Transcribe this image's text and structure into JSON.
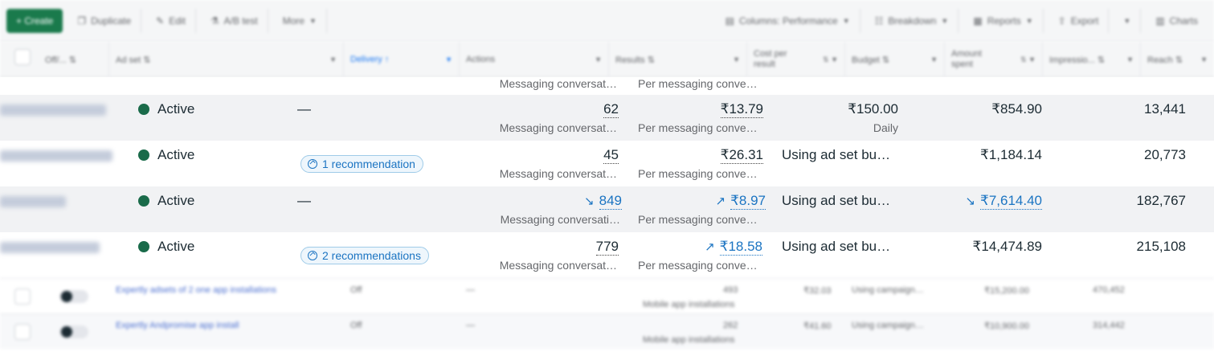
{
  "toolbar": {
    "create": "+ Create",
    "duplicate": "Duplicate",
    "edit": "Edit",
    "ab_test": "A/B test",
    "more": "More",
    "columns": "Columns: Performance",
    "breakdown": "Breakdown",
    "reports": "Reports",
    "export": "Export",
    "charts": "Charts"
  },
  "columns": {
    "off_on": "Off/... ⇅",
    "ad_set": "Ad set ⇅",
    "delivery": "Delivery ↑",
    "actions": "Actions",
    "results": "Results ⇅",
    "cost_per_result": "Cost per result",
    "budget": "Budget ⇅",
    "amount_spent": "Amount spent",
    "impressions": "Impressio... ⇅",
    "reach": "Reach ⇅"
  },
  "partial_row": {
    "results_sub": "Messaging conversat…",
    "cost_sub": "Per messaging conve…"
  },
  "rows": [
    {
      "status": "Active",
      "delivery": "—",
      "results": "62",
      "results_sub": "Messaging conversat…",
      "cost": "₹13.79",
      "cost_sub": "Per messaging conve…",
      "budget": "₹150.00",
      "budget_sub": "Daily",
      "spent": "₹854.90",
      "reach": "13,441"
    },
    {
      "status": "Active",
      "delivery": "1 recommendation",
      "results": "45",
      "results_sub": "Messaging conversat…",
      "cost": "₹26.31",
      "cost_sub": "Per messaging conve…",
      "budget": "Using ad set bu…",
      "spent": "₹1,184.14",
      "reach": "20,773"
    },
    {
      "status": "Active",
      "delivery": "—",
      "results": "849",
      "results_sub": "Messaging conversati…",
      "cost": "₹8.97",
      "cost_sub": "Per messaging conve…",
      "budget": "Using ad set bu…",
      "spent": "₹7,614.40",
      "reach": "182,767"
    },
    {
      "status": "Active",
      "delivery": "2 recommendations",
      "results": "779",
      "results_sub": "Messaging conversat…",
      "cost": "₹18.58",
      "cost_sub": "Per messaging conve…",
      "budget": "Using ad set bu…",
      "spent": "₹14,474.89",
      "reach": "215,108"
    }
  ],
  "lower_rows": [
    {
      "name": "Expertly adsets of 2 one app installations",
      "status": "Off",
      "delivery": "—",
      "results": "493",
      "results_sub": "Mobile app installations",
      "cost": "₹32.03",
      "budget": "Using campaign…",
      "spent": "₹15,200.00",
      "impressions": "470,452"
    },
    {
      "name": "Expertly Andpromise app install",
      "status": "Off",
      "delivery": "—",
      "results": "262",
      "results_sub": "Mobile app installations",
      "cost": "₹41.60",
      "budget": "Using campaign…",
      "spent": "₹10,900.00",
      "impressions": "314,442"
    }
  ],
  "colors": {
    "active_dot": "#1a6b4a",
    "link_blue": "#1b74c2",
    "create_green": "#1a7a4c"
  }
}
